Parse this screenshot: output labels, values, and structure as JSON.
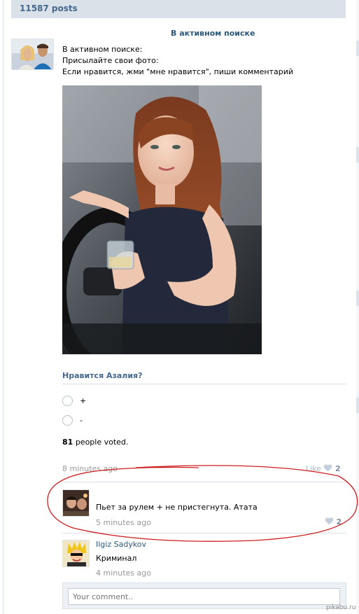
{
  "header": {
    "posts_count": "11587 posts"
  },
  "post": {
    "title": "В активном поиске",
    "lines": [
      "В активном поиске:",
      "Присылайте свои фото:",
      "Если нравится, жми \"мне нравится\", пиши комментарий"
    ],
    "time": "8 minutes ago",
    "like_label": "Like",
    "like_count": "2"
  },
  "poll": {
    "title": "Нравится Азалия?",
    "options": [
      "+",
      "-"
    ],
    "votes": "81",
    "votes_suffix": "people voted."
  },
  "comments": [
    {
      "author": "",
      "text": "Пьет за рулем + не пристегнута. Атата",
      "time": "5 minutes ago",
      "likes": "2"
    },
    {
      "author": "Ilgiz Sadykov",
      "text": "Криминал",
      "time": "4 minutes ago",
      "likes": ""
    }
  ],
  "reply": {
    "placeholder": "Your comment.."
  },
  "watermark": "pikabu.ru",
  "colors": {
    "link": "#2b587a",
    "header_bg": "#dae1e8",
    "annotation": "#cc1f1f"
  },
  "icons": {
    "like": "heart-icon"
  }
}
